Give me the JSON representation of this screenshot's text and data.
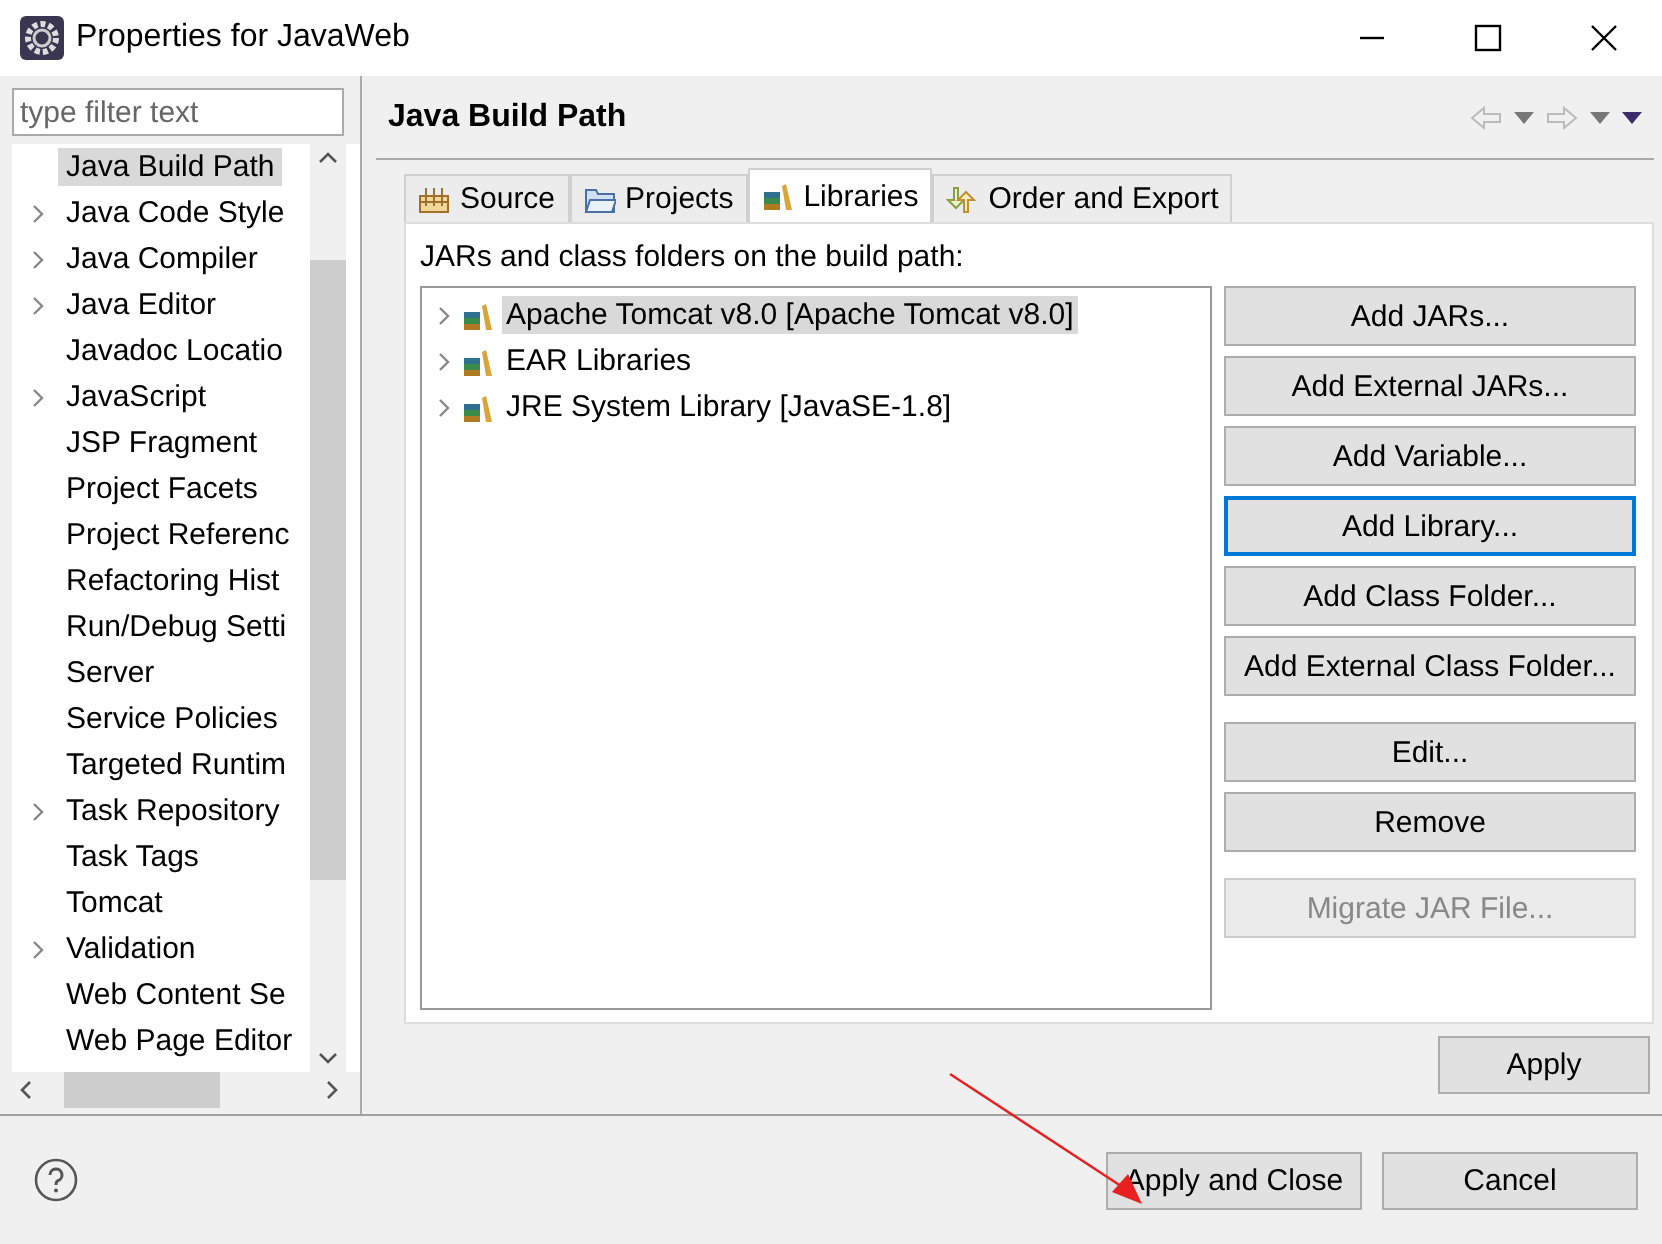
{
  "window": {
    "title": "Properties for JavaWeb"
  },
  "filter": {
    "placeholder": "type filter text"
  },
  "sidebar": {
    "items": [
      {
        "label": "Java Build Path",
        "expandable": false,
        "selected": true
      },
      {
        "label": "Java Code Style",
        "expandable": true,
        "selected": false
      },
      {
        "label": "Java Compiler",
        "expandable": true,
        "selected": false
      },
      {
        "label": "Java Editor",
        "expandable": true,
        "selected": false
      },
      {
        "label": "Javadoc Locatio",
        "expandable": false,
        "selected": false
      },
      {
        "label": "JavaScript",
        "expandable": true,
        "selected": false
      },
      {
        "label": "JSP Fragment",
        "expandable": false,
        "selected": false
      },
      {
        "label": "Project Facets",
        "expandable": false,
        "selected": false
      },
      {
        "label": "Project Referenc",
        "expandable": false,
        "selected": false
      },
      {
        "label": "Refactoring Hist",
        "expandable": false,
        "selected": false
      },
      {
        "label": "Run/Debug Setti",
        "expandable": false,
        "selected": false
      },
      {
        "label": "Server",
        "expandable": false,
        "selected": false
      },
      {
        "label": "Service Policies",
        "expandable": false,
        "selected": false
      },
      {
        "label": "Targeted Runtim",
        "expandable": false,
        "selected": false
      },
      {
        "label": "Task Repository",
        "expandable": true,
        "selected": false
      },
      {
        "label": "Task Tags",
        "expandable": false,
        "selected": false
      },
      {
        "label": "Tomcat",
        "expandable": false,
        "selected": false
      },
      {
        "label": "Validation",
        "expandable": true,
        "selected": false
      },
      {
        "label": "Web Content Se",
        "expandable": false,
        "selected": false
      },
      {
        "label": "Web Page Editor",
        "expandable": false,
        "selected": false
      }
    ]
  },
  "page": {
    "title": "Java Build Path"
  },
  "tabs": [
    {
      "label": "Source",
      "selected": false
    },
    {
      "label": "Projects",
      "selected": false
    },
    {
      "label": "Libraries",
      "selected": true
    },
    {
      "label": "Order and Export",
      "selected": false
    }
  ],
  "list": {
    "label": "JARs and class folders on the build path:",
    "items": [
      {
        "label": "Apache Tomcat v8.0 [Apache Tomcat v8.0]",
        "selected": true
      },
      {
        "label": "EAR Libraries",
        "selected": false
      },
      {
        "label": "JRE System Library [JavaSE-1.8]",
        "selected": false
      }
    ]
  },
  "buttons": [
    {
      "label": "Add JARs...",
      "disabled": false,
      "focused": false
    },
    {
      "label": "Add External JARs...",
      "disabled": false,
      "focused": false
    },
    {
      "label": "Add Variable...",
      "disabled": false,
      "focused": false
    },
    {
      "label": "Add Library...",
      "disabled": false,
      "focused": true
    },
    {
      "label": "Add Class Folder...",
      "disabled": false,
      "focused": false
    },
    {
      "label": "Add External Class Folder...",
      "disabled": false,
      "focused": false
    },
    {
      "label": "Edit...",
      "disabled": false,
      "focused": false
    },
    {
      "label": "Remove",
      "disabled": false,
      "focused": false
    },
    {
      "label": "Migrate JAR File...",
      "disabled": true,
      "focused": false
    }
  ],
  "apply": "Apply",
  "footer": {
    "buttons": [
      "Apply and Close",
      "Cancel"
    ]
  }
}
